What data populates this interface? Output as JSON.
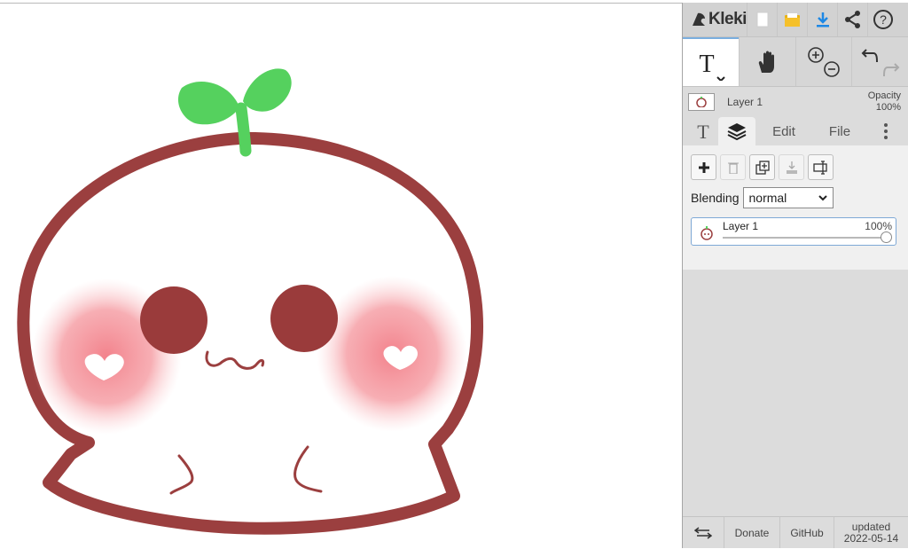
{
  "app": {
    "name": "Kleki"
  },
  "toolbar": {
    "icons": [
      "new-image-icon",
      "open-folder-icon",
      "download-icon",
      "share-icon",
      "help-icon"
    ]
  },
  "tools": [
    "text-tool-icon",
    "hand-tool-icon",
    "zoom-icon",
    "undo-redo-icon"
  ],
  "layer_info": {
    "name": "Layer 1",
    "opacity_label": "Opacity",
    "opacity_value": "100%"
  },
  "tabs": {
    "edit": "Edit",
    "file": "File"
  },
  "layers_panel": {
    "blending_label": "Blending",
    "blending_value": "normal",
    "layer": {
      "name": "Layer 1",
      "opacity": "100%"
    }
  },
  "footer": {
    "donate": "Donate",
    "github": "GitHub",
    "updated_label": "updated",
    "updated_date": "2022-05-14"
  },
  "colors": {
    "outline": "#9b3f3f",
    "sprout": "#55d15e",
    "blush": "#f4a0a6",
    "eyes": "#9a3b3b",
    "accent": "#1e88e5"
  }
}
